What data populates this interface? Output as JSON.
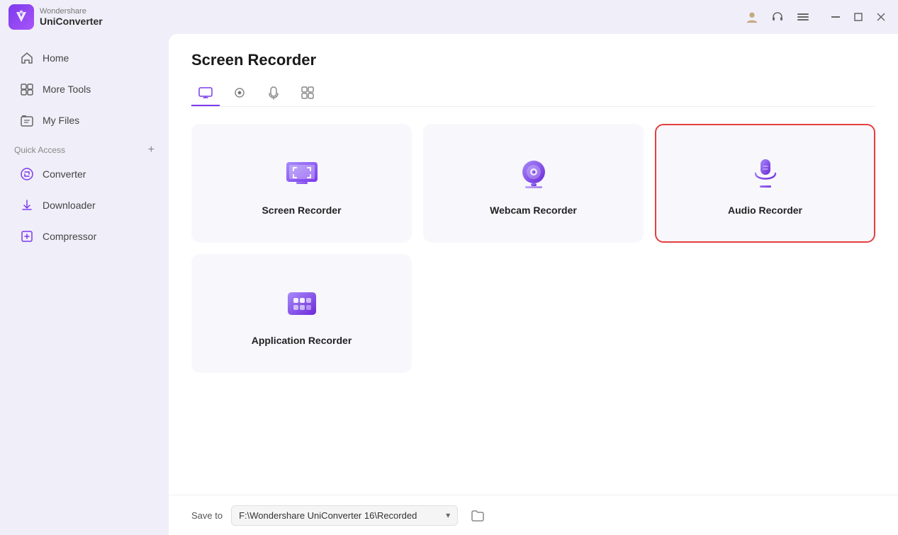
{
  "app": {
    "logo_text": "W",
    "name_line1": "Wondershare",
    "name_line2": "UniConverter"
  },
  "titlebar": {
    "icons": [
      "user",
      "headset",
      "menu",
      "minimize",
      "maximize",
      "close"
    ]
  },
  "sidebar": {
    "items": [
      {
        "id": "home",
        "label": "Home",
        "icon": "home"
      },
      {
        "id": "more-tools",
        "label": "More Tools",
        "icon": "tools"
      },
      {
        "id": "my-files",
        "label": "My Files",
        "icon": "files"
      }
    ],
    "quick_access_label": "Quick Access",
    "quick_access_items": [
      {
        "id": "converter",
        "label": "Converter",
        "icon": "converter"
      },
      {
        "id": "downloader",
        "label": "Downloader",
        "icon": "downloader"
      },
      {
        "id": "compressor",
        "label": "Compressor",
        "icon": "compressor"
      }
    ]
  },
  "page": {
    "title": "Screen Recorder",
    "tabs": [
      {
        "id": "screen",
        "icon": "screen"
      },
      {
        "id": "webcam",
        "icon": "webcam"
      },
      {
        "id": "audio",
        "icon": "audio"
      },
      {
        "id": "app",
        "icon": "appgrid"
      }
    ],
    "active_tab": "screen"
  },
  "cards": [
    {
      "id": "screen-recorder",
      "label": "Screen Recorder",
      "icon": "screen-recorder",
      "selected": false
    },
    {
      "id": "webcam-recorder",
      "label": "Webcam Recorder",
      "icon": "webcam-recorder",
      "selected": false
    },
    {
      "id": "audio-recorder",
      "label": "Audio Recorder",
      "icon": "audio-recorder",
      "selected": true
    },
    {
      "id": "application-recorder",
      "label": "Application Recorder",
      "icon": "application-recorder",
      "selected": false
    }
  ],
  "bottom_bar": {
    "save_to_label": "Save to",
    "path": "F:\\Wondershare UniConverter 16\\Recorded",
    "dropdown_arrow": "▾"
  }
}
